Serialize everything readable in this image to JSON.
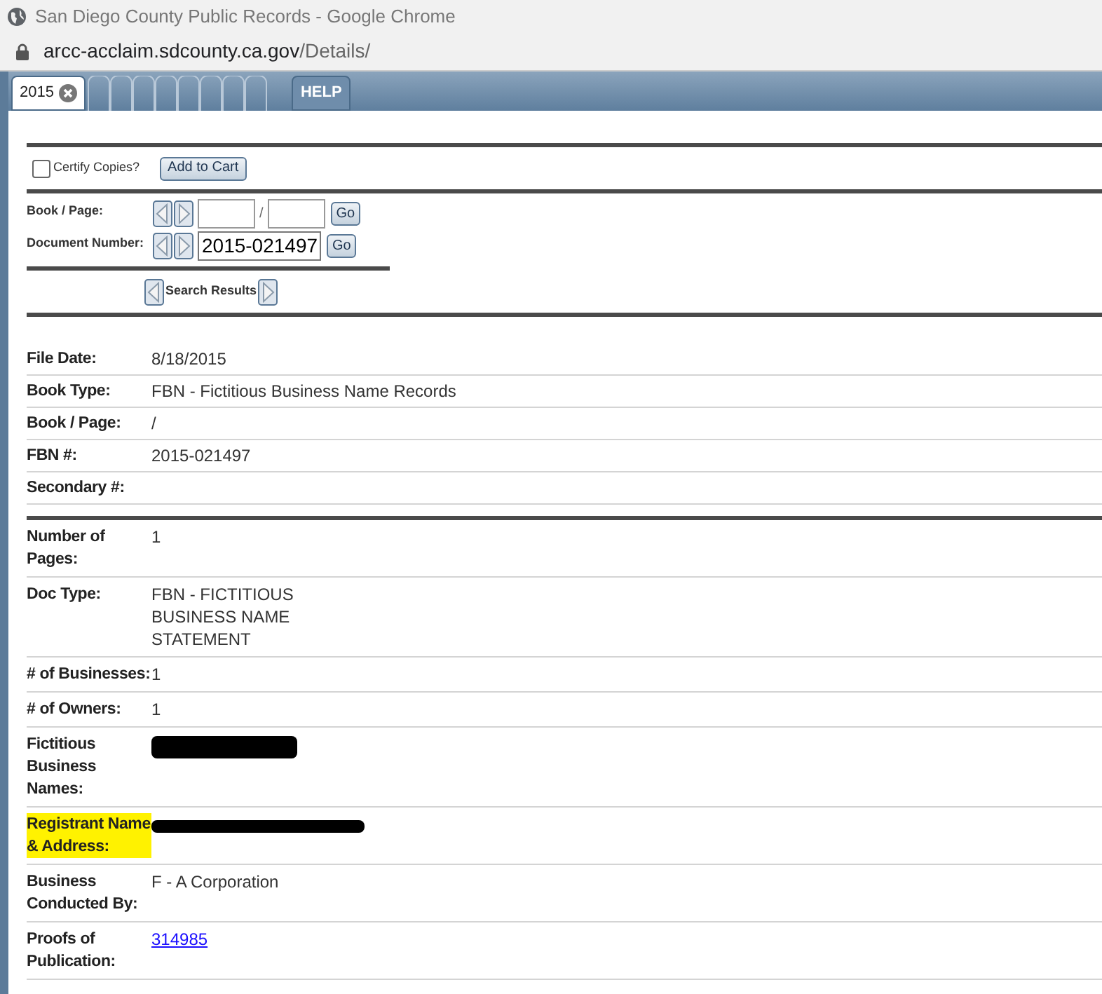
{
  "window": {
    "title": "San Diego County Public Records - Google Chrome"
  },
  "address_bar": {
    "host": "arcc-acclaim.sdcounty.ca.gov",
    "path": "/Details/"
  },
  "tabs": [
    {
      "label": "2015",
      "selected": true,
      "closable": true
    },
    {
      "label": "HELP",
      "selected": false,
      "closable": false
    }
  ],
  "cart": {
    "certify_label": "Certify Copies?",
    "certify_checked": false,
    "button": "Add to Cart"
  },
  "navigation": [
    {
      "label": "Book / Page:",
      "kind": "book_page",
      "separator": "/",
      "go": "Go"
    },
    {
      "label": "Document Number:",
      "kind": "document",
      "value": "2015-021497",
      "go": "Go"
    }
  ],
  "search_results": {
    "label": "Search Results"
  },
  "summary": [
    {
      "label": "File Date:",
      "value": "8/18/2015"
    },
    {
      "label": "Book Type:",
      "value": "FBN - Fictitious Business Name Records"
    },
    {
      "label": "Book / Page:",
      "value": "/"
    },
    {
      "label": "FBN #:",
      "value": "2015-021497"
    },
    {
      "label": "Secondary #:"
    }
  ],
  "details": [
    {
      "label": "Number of Pages:",
      "value": "1",
      "kind": "text",
      "highlighted": false
    },
    {
      "label": "Doc Type:",
      "value": "FBN - FICTITIOUS BUSINESS NAME STATEMENT",
      "kind": "text",
      "highlighted": false
    },
    {
      "label": "# of Businesses:",
      "value": "1",
      "kind": "text",
      "highlighted": false
    },
    {
      "label": "# of Owners:",
      "value": "1",
      "kind": "text",
      "highlighted": false
    },
    {
      "label": "Fictitious Business Names:",
      "kind": "redacted_block",
      "highlighted": false
    },
    {
      "label": "Registrant Name & Address:",
      "kind": "redacted_line",
      "highlighted": true
    },
    {
      "label": "Business Conducted By:",
      "value": "F - A Corporation",
      "kind": "text",
      "highlighted": false
    },
    {
      "label": "Proofs of Publication:",
      "value": "314985",
      "kind": "link",
      "highlighted": false
    }
  ]
}
